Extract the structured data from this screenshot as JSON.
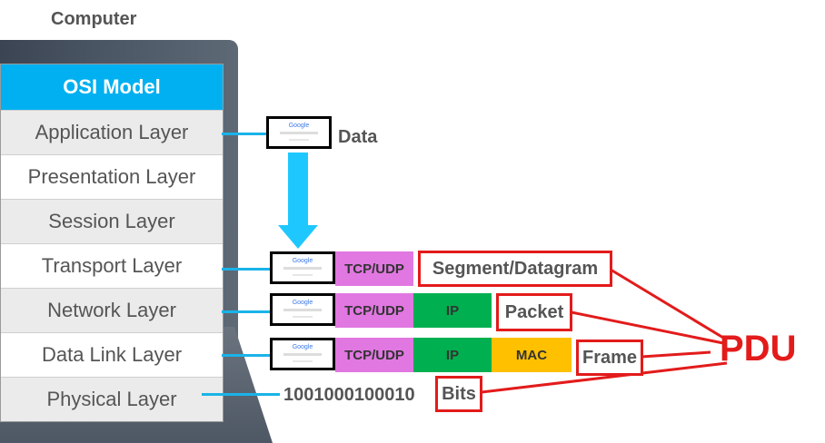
{
  "computer_label": "Computer",
  "osi": {
    "title": "OSI Model",
    "layers": [
      "Application Layer",
      "Presentation Layer",
      "Session Layer",
      "Transport Layer",
      "Network Layer",
      "Data Link Layer",
      "Physical Layer"
    ]
  },
  "encapsulation": {
    "data_label": "Data",
    "thumbnail_text": "Google",
    "tcp_udp": "TCP/UDP",
    "ip": "IP",
    "mac": "MAC",
    "bits_value": "1001000100010"
  },
  "pdu": {
    "label": "PDU",
    "segment": "Segment/Datagram",
    "packet": "Packet",
    "frame": "Frame",
    "bits": "Bits"
  },
  "colors": {
    "osi_header": "#00b0f0",
    "arrow": "#1ec8ff",
    "tcp_udp": "#e177e1",
    "ip": "#00b050",
    "mac": "#ffc000",
    "pdu": "#e31b1b"
  }
}
